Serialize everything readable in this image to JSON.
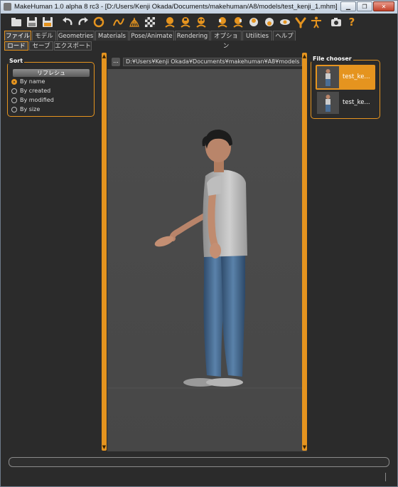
{
  "window": {
    "title": "MakeHuman 1.0 alpha 8 rc3 - [D:/Users/Kenji Okada/Documents/makehuman/A8/models/test_kenji_1.mhm]",
    "minimize": "▁",
    "restore": "❐",
    "close": "✕"
  },
  "toolbar": {
    "icons": [
      "new-file-icon",
      "save-icon",
      "save-as-icon",
      "undo-icon",
      "redo-icon",
      "reset-icon",
      "smooth-icon",
      "wireframe-icon",
      "checker-icon",
      "front-view-icon",
      "back-view-icon",
      "side-view-icon",
      "left-view-icon",
      "right-view-icon",
      "top-view-icon",
      "bottom-view-icon",
      "pose-view-icon",
      "skeleton-icon",
      "screenshot-icon",
      "help-icon"
    ],
    "help": "?"
  },
  "tabs": [
    "ファイル",
    "モデル",
    "Geometries",
    "Materials",
    "Pose/Animate",
    "Rendering",
    "オプション",
    "Utilities",
    "ヘルプ"
  ],
  "active_tab": "ファイル",
  "subtabs": [
    "ロード",
    "セーブ",
    "エクスポート"
  ],
  "active_subtab": "ロード",
  "sort": {
    "title": "Sort",
    "refresh_label": "リフレシュ",
    "options": [
      "By name",
      "By created",
      "By modified",
      "By size"
    ],
    "selected": "By name"
  },
  "path": {
    "browse_label": "...",
    "value": "D:¥Users¥Kenji Okada¥Documents¥makehuman¥A8¥models"
  },
  "file_chooser": {
    "title": "File chooser",
    "files": [
      "test_ke...",
      "test_ke..."
    ],
    "selected_index": 0
  },
  "colors": {
    "accent": "#e5941f",
    "background": "#2b2b2b",
    "viewport": "#4a4a4a"
  }
}
